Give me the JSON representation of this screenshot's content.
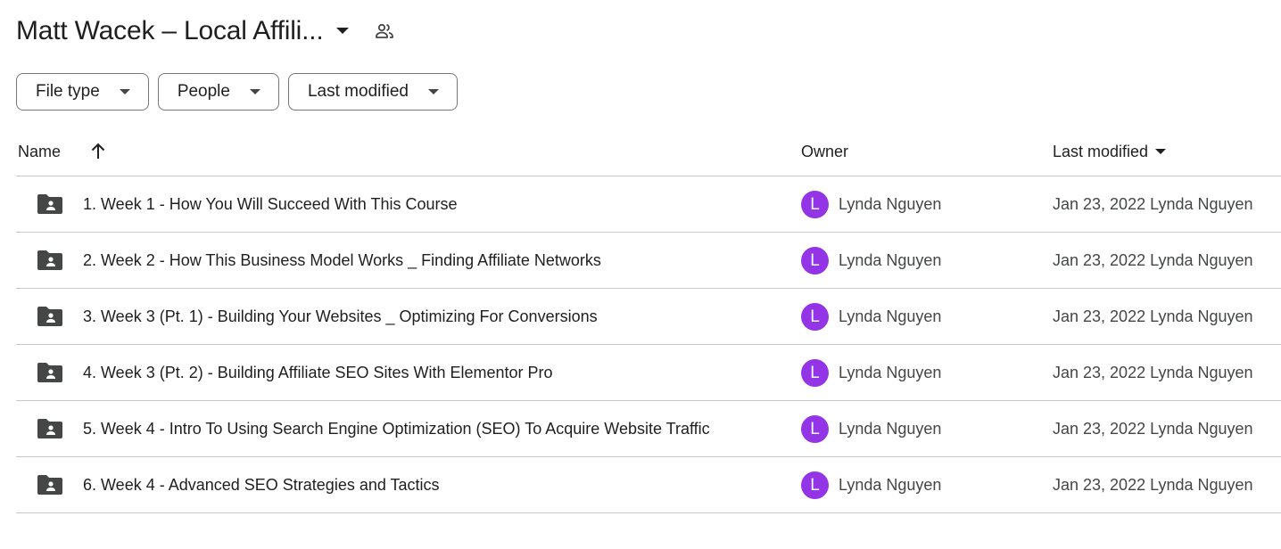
{
  "header": {
    "folder_title": "Matt Wacek – Local Affili...",
    "icons": {
      "dropdown": "chevron-down-icon",
      "shared": "shared-people-icon"
    }
  },
  "filters": [
    {
      "label": "File type"
    },
    {
      "label": "People"
    },
    {
      "label": "Last modified"
    }
  ],
  "table": {
    "columns": {
      "name": "Name",
      "owner": "Owner",
      "last_modified": "Last modified"
    },
    "sort": {
      "column": "name",
      "direction": "ascending",
      "icon": "arrow-up-icon"
    },
    "rows": [
      {
        "name": "1. Week 1 - How You Will Succeed With This Course",
        "owner_initial": "L",
        "owner": "Lynda Nguyen",
        "modified": "Jan 23, 2022",
        "modified_by": "Lynda Nguyen"
      },
      {
        "name": "2. Week 2 - How This Business Model Works _ Finding Affiliate Networks",
        "owner_initial": "L",
        "owner": "Lynda Nguyen",
        "modified": "Jan 23, 2022",
        "modified_by": "Lynda Nguyen"
      },
      {
        "name": "3. Week 3 (Pt. 1) - Building Your Websites _ Optimizing For Conversions",
        "owner_initial": "L",
        "owner": "Lynda Nguyen",
        "modified": "Jan 23, 2022",
        "modified_by": "Lynda Nguyen"
      },
      {
        "name": "4. Week 3 (Pt. 2) - Building Affiliate SEO Sites With Elementor Pro",
        "owner_initial": "L",
        "owner": "Lynda Nguyen",
        "modified": "Jan 23, 2022",
        "modified_by": "Lynda Nguyen"
      },
      {
        "name": "5. Week 4 - Intro To Using Search Engine Optimization (SEO) To Acquire Website Traffic",
        "owner_initial": "L",
        "owner": "Lynda Nguyen",
        "modified": "Jan 23, 2022",
        "modified_by": "Lynda Nguyen"
      },
      {
        "name": "6. Week 4 - Advanced SEO Strategies and Tactics",
        "owner_initial": "L",
        "owner": "Lynda Nguyen",
        "modified": "Jan 23, 2022",
        "modified_by": "Lynda Nguyen"
      }
    ]
  },
  "colors": {
    "avatar": "#9334e6",
    "border": "#c7c7c7",
    "icon": "#444746"
  }
}
